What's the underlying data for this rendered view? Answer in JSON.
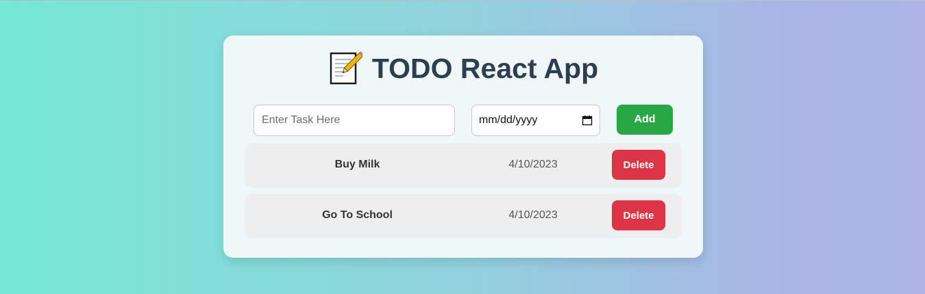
{
  "app": {
    "title": "TODO React App",
    "title_icon": "memo-icon"
  },
  "form": {
    "task_placeholder": "Enter Task Here",
    "task_value": "",
    "date_placeholder": "mm/dd/yyyy",
    "date_icon": "calendar-icon",
    "add_label": "Add"
  },
  "todos": [
    {
      "name": "Buy Milk",
      "date": "4/10/2023",
      "delete_label": "Delete"
    },
    {
      "name": "Go To School",
      "date": "4/10/2023",
      "delete_label": "Delete"
    }
  ],
  "colors": {
    "add_button": "#28a745",
    "delete_button": "#dc3545",
    "title_text": "#2d3e50",
    "card_background": "#eff7f9"
  }
}
